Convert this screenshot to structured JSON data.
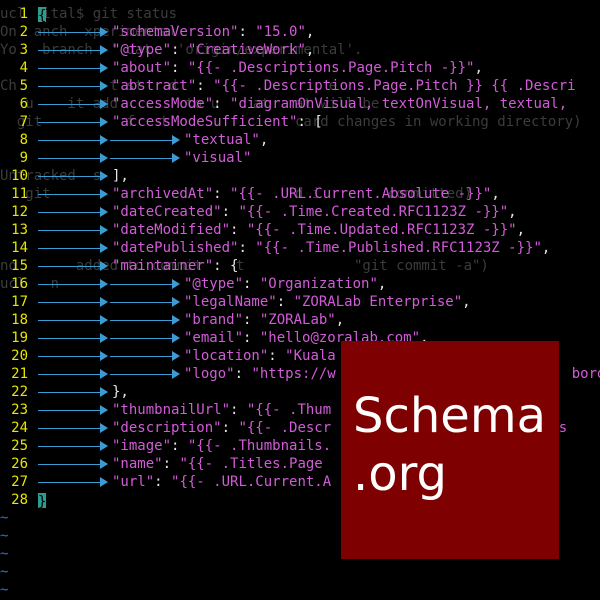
{
  "background_terminal": {
    "lines": [
      "ucl  ital$ git status",
      "On  anch  xperimental",
      "Yo   branch  ' dat   'origin/experimental'.",
      "",
      "Ch           t st   d                  e",
      "   u    it add   ..   to u    at   at will be",
      "  git          f   t               card changes in working directory)",
      "",
      "",
      "Untracked  s",
      "   git                             d i        committed)",
      "",
      "",
      "",
      "no       added to commit    t             \"git commit -a\")",
      "ucl   n   "
    ]
  },
  "editor": {
    "lines": [
      {
        "n": "1",
        "tabs": 0,
        "parts": [
          [
            "cursor",
            "{"
          ]
        ]
      },
      {
        "n": "2",
        "tabs": 1,
        "parts": [
          [
            "str",
            "\"schemaVersion\""
          ],
          [
            "pun",
            ": "
          ],
          [
            "str",
            "\"15.0\""
          ],
          [
            "pun",
            ","
          ]
        ]
      },
      {
        "n": "3",
        "tabs": 1,
        "parts": [
          [
            "str",
            "\"@type\""
          ],
          [
            "pun",
            ": "
          ],
          [
            "str",
            "\"CreativeWork\""
          ],
          [
            "pun",
            ","
          ]
        ]
      },
      {
        "n": "4",
        "tabs": 1,
        "parts": [
          [
            "str",
            "\"about\""
          ],
          [
            "pun",
            ": "
          ],
          [
            "str",
            "\"{{- .Descriptions.Page.Pitch -}}\""
          ],
          [
            "pun",
            ","
          ]
        ]
      },
      {
        "n": "5",
        "tabs": 1,
        "parts": [
          [
            "str",
            "\"abstract\""
          ],
          [
            "pun",
            ": "
          ],
          [
            "str",
            "\"{{- .Descriptions.Page.Pitch }} {{ .Descri"
          ]
        ]
      },
      {
        "n": "6",
        "tabs": 1,
        "parts": [
          [
            "str",
            "\"accessMode\""
          ],
          [
            "pun",
            ": "
          ],
          [
            "str",
            "\"diagramOnVisual, textOnVisual, textual,"
          ]
        ]
      },
      {
        "n": "7",
        "tabs": 1,
        "parts": [
          [
            "str",
            "\"accessModeSufficient\""
          ],
          [
            "pun",
            ": ["
          ]
        ]
      },
      {
        "n": "8",
        "tabs": 2,
        "parts": [
          [
            "str",
            "\"textual\""
          ],
          [
            "pun",
            ","
          ]
        ]
      },
      {
        "n": "9",
        "tabs": 2,
        "parts": [
          [
            "str",
            "\"visual\""
          ]
        ]
      },
      {
        "n": "10",
        "tabs": 1,
        "parts": [
          [
            "pun",
            "],"
          ]
        ]
      },
      {
        "n": "11",
        "tabs": 1,
        "parts": [
          [
            "str",
            "\"archivedAt\""
          ],
          [
            "pun",
            ": "
          ],
          [
            "str",
            "\"{{- .URL.Current.Absolute -}}\""
          ],
          [
            "pun",
            ","
          ]
        ]
      },
      {
        "n": "12",
        "tabs": 1,
        "parts": [
          [
            "str",
            "\"dateCreated\""
          ],
          [
            "pun",
            ": "
          ],
          [
            "str",
            "\"{{- .Time.Created.RFC1123Z -}}\""
          ],
          [
            "pun",
            ","
          ]
        ]
      },
      {
        "n": "13",
        "tabs": 1,
        "parts": [
          [
            "str",
            "\"dateModified\""
          ],
          [
            "pun",
            ": "
          ],
          [
            "str",
            "\"{{- .Time.Updated.RFC1123Z -}}\""
          ],
          [
            "pun",
            ","
          ]
        ]
      },
      {
        "n": "14",
        "tabs": 1,
        "parts": [
          [
            "str",
            "\"datePublished\""
          ],
          [
            "pun",
            ": "
          ],
          [
            "str",
            "\"{{- .Time.Published.RFC1123Z -}}\""
          ],
          [
            "pun",
            ","
          ]
        ]
      },
      {
        "n": "15",
        "tabs": 1,
        "parts": [
          [
            "str",
            "\"maintainer\""
          ],
          [
            "pun",
            ": {"
          ]
        ]
      },
      {
        "n": "16",
        "tabs": 2,
        "parts": [
          [
            "str",
            "\"@type\""
          ],
          [
            "pun",
            ": "
          ],
          [
            "str",
            "\"Organization\""
          ],
          [
            "pun",
            ","
          ]
        ]
      },
      {
        "n": "17",
        "tabs": 2,
        "parts": [
          [
            "str",
            "\"legalName\""
          ],
          [
            "pun",
            ": "
          ],
          [
            "str",
            "\"ZORALab Enterprise\""
          ],
          [
            "pun",
            ","
          ]
        ]
      },
      {
        "n": "18",
        "tabs": 2,
        "parts": [
          [
            "str",
            "\"brand\""
          ],
          [
            "pun",
            ": "
          ],
          [
            "str",
            "\"ZORALab\""
          ],
          [
            "pun",
            ","
          ]
        ]
      },
      {
        "n": "19",
        "tabs": 2,
        "parts": [
          [
            "str",
            "\"email\""
          ],
          [
            "pun",
            ": "
          ],
          [
            "str",
            "\"hello@zoralab.com\""
          ],
          [
            "pun",
            ","
          ]
        ]
      },
      {
        "n": "20",
        "tabs": 2,
        "parts": [
          [
            "str",
            "\"location\""
          ],
          [
            "pun",
            ": "
          ],
          [
            "str",
            "\"Kuala"
          ]
        ]
      },
      {
        "n": "21",
        "tabs": 2,
        "parts": [
          [
            "str",
            "\"logo\""
          ],
          [
            "pun",
            ": "
          ],
          [
            "str",
            "\"https://w"
          ],
          [
            "str",
            "                            borde"
          ]
        ]
      },
      {
        "n": "22",
        "tabs": 1,
        "parts": [
          [
            "pun",
            "},"
          ]
        ]
      },
      {
        "n": "23",
        "tabs": 1,
        "parts": [
          [
            "str",
            "\"thumbnailUrl\""
          ],
          [
            "pun",
            ": "
          ],
          [
            "str",
            "\"{{- .Thum"
          ],
          [
            "str",
            "                       }}\""
          ],
          [
            "pun",
            ","
          ]
        ]
      },
      {
        "n": "24",
        "tabs": 1,
        "parts": [
          [
            "str",
            "\"description\""
          ],
          [
            "pun",
            ": "
          ],
          [
            "str",
            "\"{{- .Descr"
          ],
          [
            "str",
            "                        .Des"
          ]
        ]
      },
      {
        "n": "25",
        "tabs": 1,
        "parts": [
          [
            "str",
            "\"image\""
          ],
          [
            "pun",
            ": "
          ],
          [
            "str",
            "\"{{- .Thumbnails."
          ]
        ]
      },
      {
        "n": "26",
        "tabs": 1,
        "parts": [
          [
            "str",
            "\"name\""
          ],
          [
            "pun",
            ": "
          ],
          [
            "str",
            "\"{{- .Titles.Page"
          ]
        ]
      },
      {
        "n": "27",
        "tabs": 1,
        "parts": [
          [
            "str",
            "\"url\""
          ],
          [
            "pun",
            ": "
          ],
          [
            "str",
            "\"{{- .URL.Current.A"
          ]
        ]
      },
      {
        "n": "28",
        "tabs": 0,
        "parts": [
          [
            "cursor",
            "}"
          ]
        ]
      }
    ],
    "empty_line_marker": "~",
    "empty_lines": 5
  },
  "logo": {
    "line1": "Schema",
    "line2": ".org",
    "color": "#7f0000"
  },
  "colors": {
    "background": "#000000",
    "line_number": "#e6e600",
    "string": "#d25cd8",
    "tab_indicator": "#3b9bd3",
    "cursor": "#2a9d8f",
    "tilde": "#2e6fd6"
  }
}
